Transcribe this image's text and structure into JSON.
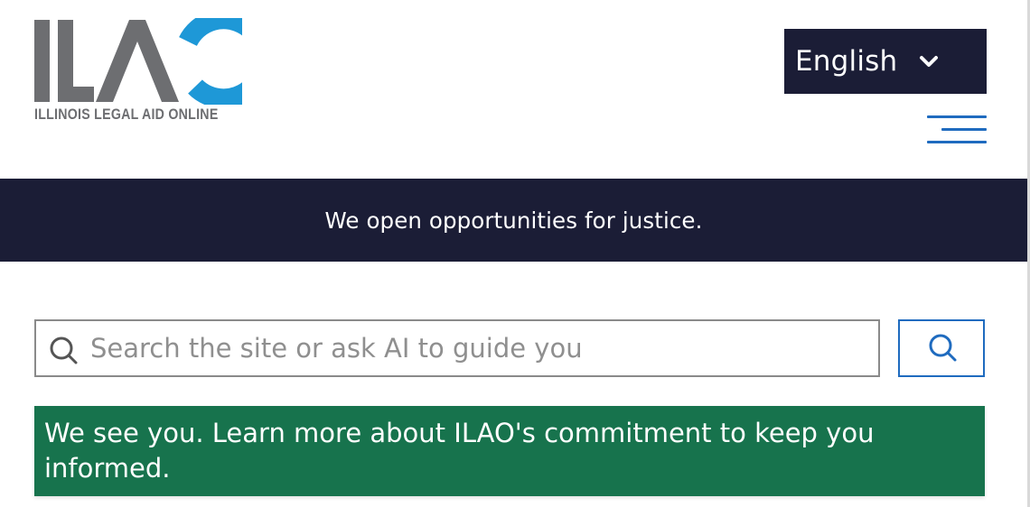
{
  "header": {
    "logo": {
      "letters": "ILAO",
      "tagline": "ILLINOIS LEGAL AID ONLINE",
      "gray": "#6d6e71",
      "blue": "#1e98d7"
    },
    "language": {
      "selected": "English",
      "icon": "chevron-down-icon"
    },
    "menu": {
      "icon": "hamburger-menu-icon"
    }
  },
  "banner": {
    "text": "We open opportunities for justice.",
    "background": "#1b1d36"
  },
  "search": {
    "placeholder": "Search the site or ask AI to guide you",
    "value": "",
    "input_icon": "search-icon",
    "button_icon": "search-icon"
  },
  "notice": {
    "text": "We see you. Learn more about ILAO's commitment to keep you informed.",
    "background": "#17734d"
  },
  "colors": {
    "navy": "#1b1d36",
    "accent_blue": "#1f6bbf",
    "green": "#17734d"
  }
}
